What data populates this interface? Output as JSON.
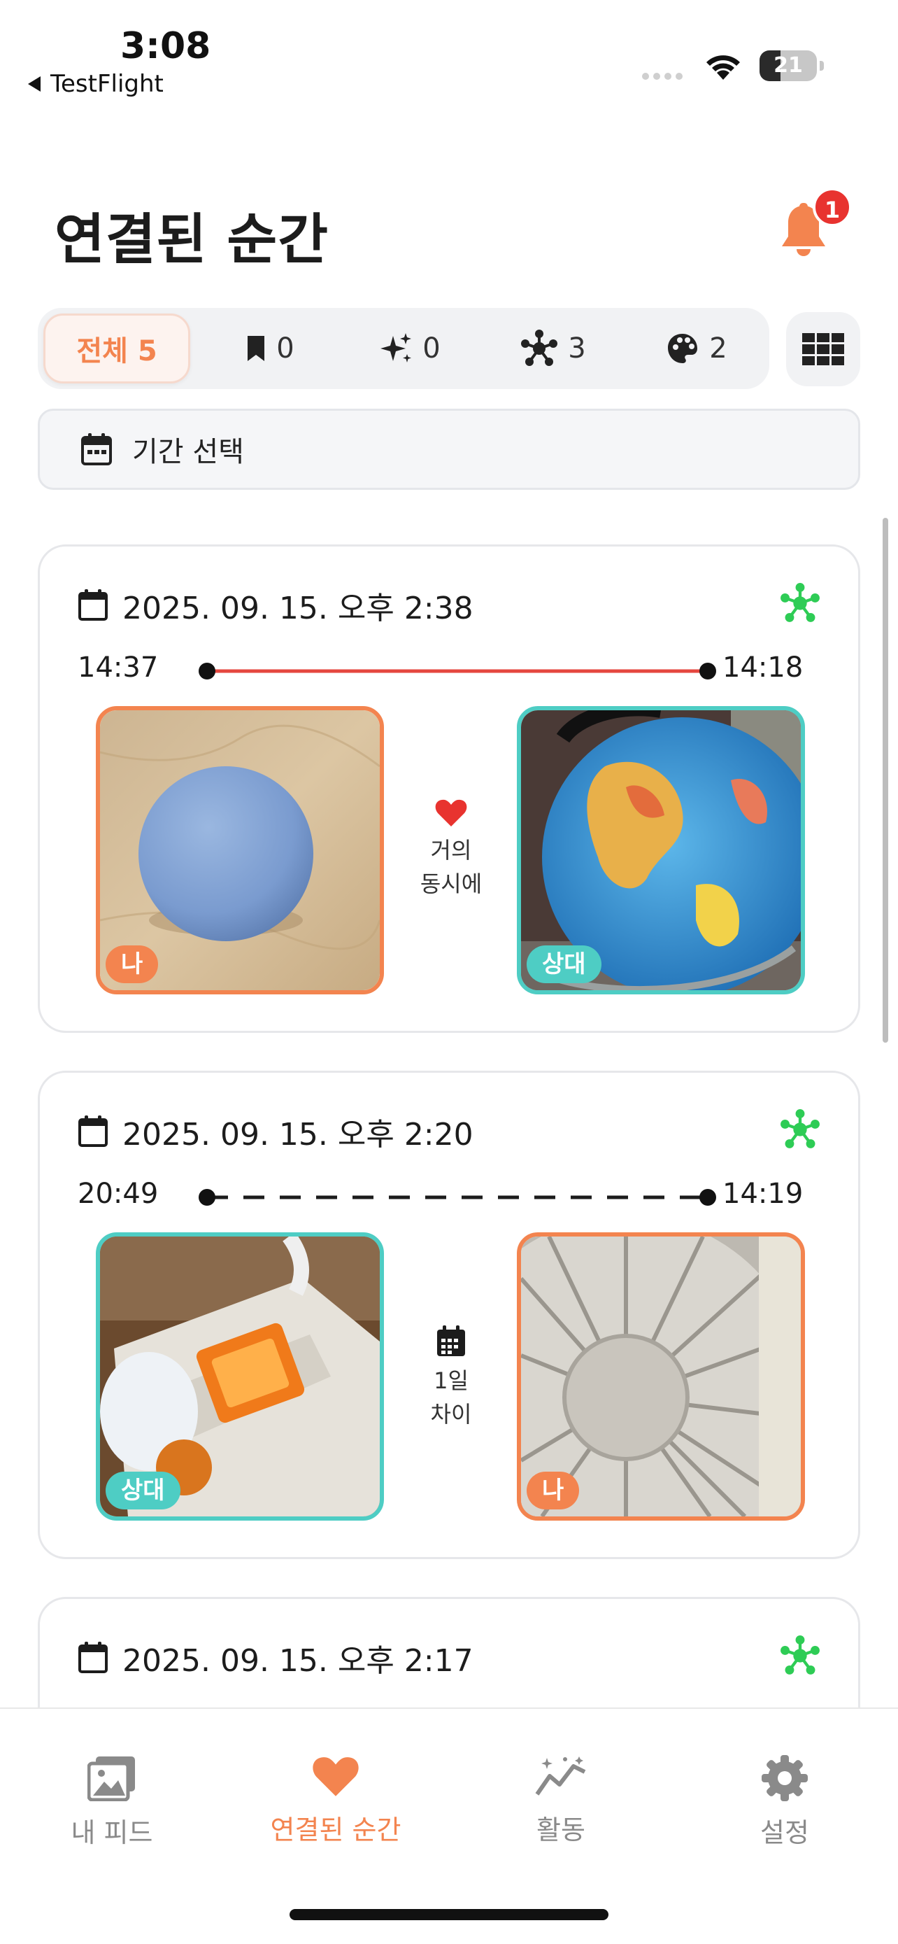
{
  "status_bar": {
    "time": "3:08",
    "back_app": "TestFlight",
    "battery": "21"
  },
  "header": {
    "title": "연결된 순간",
    "notification_count": "1"
  },
  "filters": {
    "all_label": "전체 5",
    "bookmark_count": "0",
    "sparkle_count": "0",
    "network_count": "3",
    "palette_count": "2"
  },
  "date_range": {
    "label": "기간 선택"
  },
  "cards": [
    {
      "date": "2025. 09. 15. 오후 2:38",
      "time_left": "14:37",
      "time_right": "14:18",
      "line_style": "solid-red",
      "left_photo": {
        "tag": "나",
        "subject": "blue ball",
        "owner": "me"
      },
      "right_photo": {
        "tag": "상대",
        "subject": "globe",
        "owner": "partner"
      },
      "middle_icon": "heart-icon",
      "middle_text_1": "거의",
      "middle_text_2": "동시에"
    },
    {
      "date": "2025. 09. 15. 오후 2:20",
      "time_left": "20:49",
      "time_right": "14:19",
      "line_style": "dashed-black",
      "left_photo": {
        "tag": "상대",
        "subject": "power strip",
        "owner": "partner"
      },
      "right_photo": {
        "tag": "나",
        "subject": "desk fan",
        "owner": "me"
      },
      "middle_icon": "calendar-icon",
      "middle_text_1": "1일",
      "middle_text_2": "차이"
    },
    {
      "date": "2025. 09. 15. 오후 2:17"
    }
  ],
  "tabs": [
    {
      "label": "내 피드",
      "icon": "photo-gallery-icon"
    },
    {
      "label": "연결된 순간",
      "icon": "heart-icon"
    },
    {
      "label": "활동",
      "icon": "activity-chart-icon"
    },
    {
      "label": "설정",
      "icon": "gear-icon"
    }
  ],
  "colors": {
    "accent": "#f3844f",
    "teal": "#4ecdc4",
    "red": "#e8332f",
    "green": "#2ecc55"
  }
}
